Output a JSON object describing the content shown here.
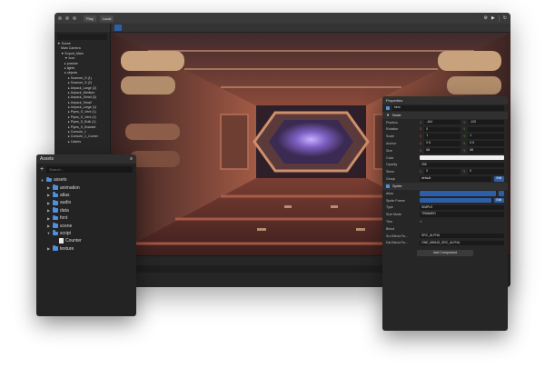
{
  "titlebar": {
    "title": "",
    "play": "▶",
    "buttons": [
      "Play",
      "Local"
    ],
    "right_items": [
      "⚙",
      "▶",
      "↻"
    ]
  },
  "toolbar2": {
    "active_tab": ""
  },
  "hierarchy": {
    "header": "",
    "items": [
      "▼ Scene",
      "Main Camera",
      "▼ Export_Main",
      "▼ Icon",
      "▸ posture",
      "▸ lights",
      "▸ objects",
      "▸ Scanner_S (1)",
      "▸ Scanner_S (2)",
      "▸ Airpack_Large (2)",
      "▸ Airpack_Medium",
      "▸ Airpack_Small (3)",
      "▸ Airpack_Small",
      "▸ Airpack_Large (1)",
      "▸ Pipes_S_Vent (1)",
      "▸ Pipes_S_Vent (2)",
      "▸ Pipes_S_Bulk (1)",
      "▸ Pipes_S_Bracket",
      "▸ Console_1",
      "▸ Console_1_Corner",
      "▸ Cables"
    ]
  },
  "scene_bottom": {
    "tabs": [
      "",
      ""
    ],
    "console_left": "",
    "console_right": ""
  },
  "assets": {
    "title": "Assets",
    "search_placeholder": "Search...",
    "tree": [
      {
        "label": "assets",
        "depth": 0,
        "type": "folder",
        "expanded": true
      },
      {
        "label": "animation",
        "depth": 1,
        "type": "folder"
      },
      {
        "label": "atlas",
        "depth": 1,
        "type": "folder"
      },
      {
        "label": "audio",
        "depth": 1,
        "type": "folder"
      },
      {
        "label": "data",
        "depth": 1,
        "type": "folder"
      },
      {
        "label": "font",
        "depth": 1,
        "type": "folder"
      },
      {
        "label": "scene",
        "depth": 1,
        "type": "folder"
      },
      {
        "label": "script",
        "depth": 1,
        "type": "folder",
        "expanded": true
      },
      {
        "label": "Counter",
        "depth": 2,
        "type": "file"
      },
      {
        "label": "texture",
        "depth": 1,
        "type": "folder"
      }
    ]
  },
  "properties": {
    "title": "Properties",
    "name_value": "hero",
    "node_section": "Node",
    "rows": [
      {
        "label": "Position",
        "x": "-164",
        "y": "-120"
      },
      {
        "label": "Rotation",
        "x": "0",
        "y": ""
      },
      {
        "label": "Scale",
        "x": "1",
        "y": "1"
      },
      {
        "label": "Anchor",
        "x": "0.5",
        "y": "0.5"
      },
      {
        "label": "Size",
        "x": "68",
        "y": "68"
      }
    ],
    "color_label": "Color",
    "opacity_label": "Opacity",
    "opacity_value": "255",
    "skew_label": "Skew",
    "skew_x": "0",
    "skew_y": "0",
    "group_label": "Group",
    "group_value": "default",
    "group_button": "Edit",
    "sprite_section": "Sprite",
    "atlas_label": "Atlas",
    "atlas_value": "",
    "atlas_button": "",
    "spriteframe_label": "Sprite Frame",
    "spriteframe_button": "Edit",
    "type_label": "Type",
    "type_value": "SIMPLE",
    "sizemode_label": "Size Mode",
    "sizemode_value": "TRIMMED",
    "trim_label": "Trim",
    "blend_label": "Blend",
    "src_label": "Src Blend Fa...",
    "src_value": "SRC_ALPHA",
    "dst_label": "Dst Blend Fa...",
    "dst_value": "ONE_MINUS_SRC_ALPHA",
    "add_component": "Add Component"
  },
  "colors": {
    "accent": "#2d5fa8",
    "folder": "#4f8fdc",
    "panel": "#262626"
  }
}
